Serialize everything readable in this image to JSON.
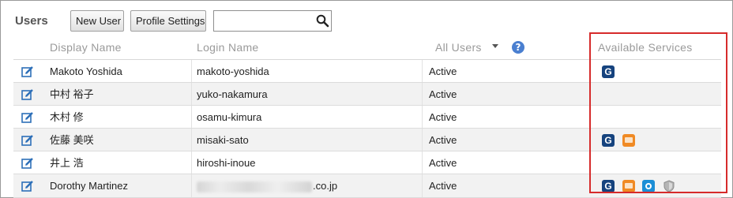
{
  "header": {
    "title": "Users",
    "new_user_label": "New User",
    "profile_settings_label": "Profile Settings",
    "search": {
      "value": "",
      "placeholder": ""
    }
  },
  "columns": {
    "display_name": "Display Name",
    "login_name": "Login Name",
    "status_filter": "All Users",
    "services": "Available Services"
  },
  "users": [
    {
      "display_name": "Makoto Yoshida",
      "login_name": "makoto-yoshida",
      "status": "Active",
      "services": [
        "garoon-icon"
      ]
    },
    {
      "display_name": "中村 裕子",
      "login_name": "yuko-nakamura",
      "status": "Active",
      "services": []
    },
    {
      "display_name": "木村 修",
      "login_name": "osamu-kimura",
      "status": "Active",
      "services": []
    },
    {
      "display_name": "佐藤 美咲",
      "login_name": "misaki-sato",
      "status": "Active",
      "services": [
        "garoon-icon",
        "mailwise-icon"
      ]
    },
    {
      "display_name": "井上 浩",
      "login_name": "hiroshi-inoue",
      "status": "Active",
      "services": []
    },
    {
      "display_name": "Dorothy Martinez",
      "login_name_suffix": ".co.jp",
      "status": "Active",
      "services": [
        "garoon-icon",
        "mailwise-icon",
        "office-icon",
        "secure-access-icon"
      ]
    }
  ],
  "colors": {
    "highlight_border": "#d62b2b",
    "garoon": "#16437e",
    "mailwise": "#f08a24",
    "office": "#1b8ed6",
    "help": "#4a7fd0"
  }
}
